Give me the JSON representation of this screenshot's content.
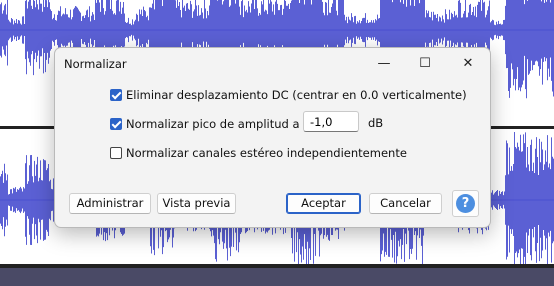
{
  "colors": {
    "accent": "#2b63c8",
    "waveform": "#4a4fd0",
    "waveform_bg": "#ffffff",
    "help": "#4d8fe0"
  },
  "dialog": {
    "title": "Normalizar",
    "window_icons": [
      "minimize-icon",
      "maximize-icon",
      "close-icon"
    ],
    "options": {
      "dc": {
        "label": "Eliminar desplazamiento DC (centrar en 0.0 verticalmente)",
        "checked": true
      },
      "peak": {
        "label": "Normalizar pico de amplitud a",
        "checked": true,
        "value": "-1,0",
        "unit": "dB"
      },
      "stereo": {
        "label": "Normalizar canales estéreo independientemente",
        "checked": false
      }
    },
    "buttons": {
      "manage": "Administrar",
      "preview": "Vista previa",
      "ok": "Aceptar",
      "cancel": "Cancelar",
      "help": "?"
    }
  }
}
